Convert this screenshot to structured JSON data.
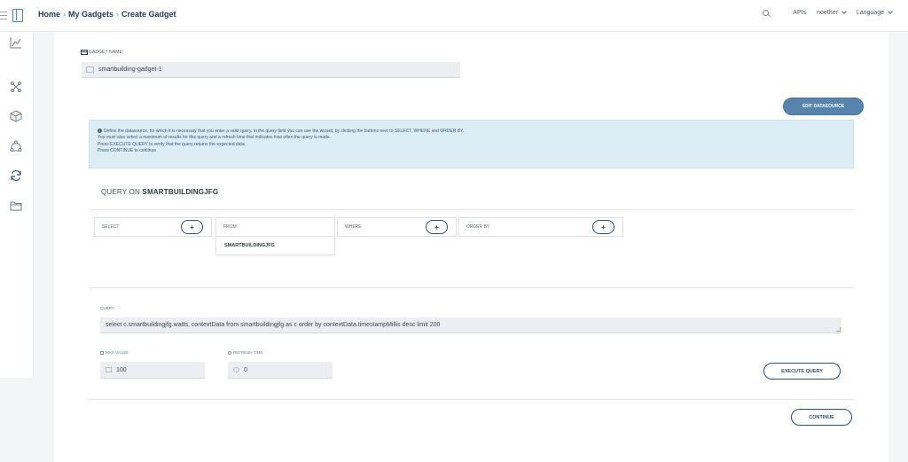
{
  "breadcrumb": {
    "items": [
      "Home",
      "My Gadgets",
      "Create Gadget"
    ]
  },
  "header": {
    "apis_label": "APIs",
    "user_label": "noether",
    "language_label": "Language"
  },
  "sidebar": {
    "icons": [
      "chart-icon",
      "network-icon",
      "cube-icon",
      "share-icon",
      "refresh-icon",
      "folder-icon"
    ]
  },
  "form": {
    "gadget_name_label": "GADGET NAME:",
    "gadget_name_value": "smartbuilding-gadget-1",
    "edit_datasource_label": "EDIT DATASOURCE",
    "info_lines": [
      "Define the datasource, for which it is necessary that you enter a valid query, in the query field you can use the wizard, by clicking the buttons next to SELECT, WHERE and ORDER BY.",
      "You must also select a maximum of results for this query and a refresh time that indicates how often the query is made.",
      "Press EXECUTE QUERY to verify that the query returns the expected data.",
      "Press CONTINUE to continue"
    ],
    "info_icon_glyph": "i"
  },
  "query": {
    "title_prefix": "QUERY ON",
    "ontology": "SMARTBUILDINGJFG",
    "select_label": "SELECT",
    "from_label": "FROM",
    "where_label": "WHERE",
    "orderby_label": "ORDER BY",
    "plus_glyph": "+",
    "from_option": "SMARTBUILDINGJFG",
    "query_label": "QUERY:",
    "query_value": "select c.smartbuildingjfg.watts, contextData from smartbuildingjfg as c order by contextData.timestampMillis desc limit 200",
    "max_value_label": "MAX VALUE:",
    "max_value": "100",
    "refresh_label": "REFRESH TIME:",
    "refresh_value": "0",
    "execute_label": "EXECUTE QUERY",
    "continue_label": "CONTINUE"
  }
}
